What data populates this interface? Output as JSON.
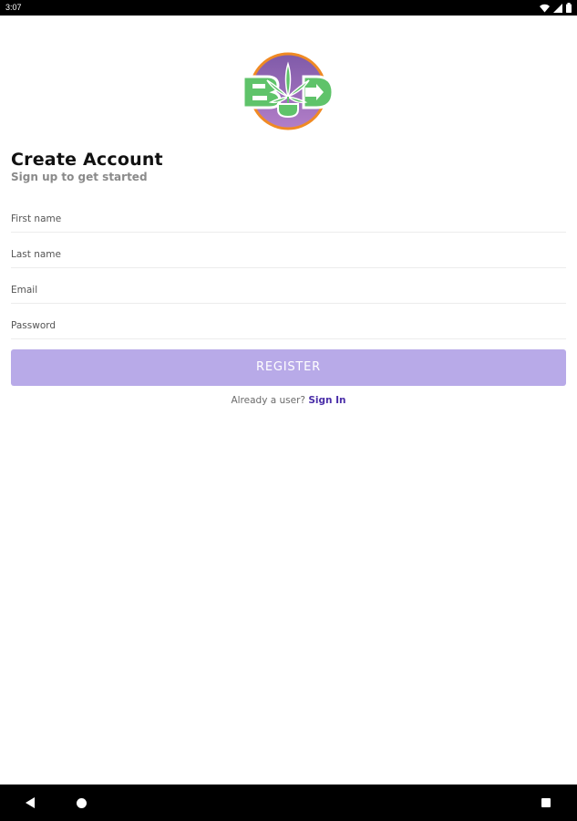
{
  "status_bar": {
    "time": "3:07",
    "icons": [
      "wifi-icon",
      "signal-icon",
      "battery-icon"
    ]
  },
  "logo": {
    "name": "bud-logo",
    "colors": {
      "circle_fill": "#9b6fc0",
      "circle_ring": "#f08a24",
      "letters": "#5fc36a",
      "leaf": "#5fc36a"
    }
  },
  "header": {
    "title": "Create Account",
    "subtitle": "Sign up to get started"
  },
  "form": {
    "first_name_placeholder": "First name",
    "last_name_placeholder": "Last name",
    "email_placeholder": "Email",
    "password_placeholder": "Password",
    "register_label": "REGISTER"
  },
  "footer": {
    "prompt": "Already a user?",
    "signin_label": "Sign In"
  },
  "colors": {
    "button": "#b8aae8",
    "link": "#4a2ea8"
  },
  "nav_bar": {
    "icons": [
      "back-icon",
      "home-icon",
      "recents-icon"
    ]
  }
}
